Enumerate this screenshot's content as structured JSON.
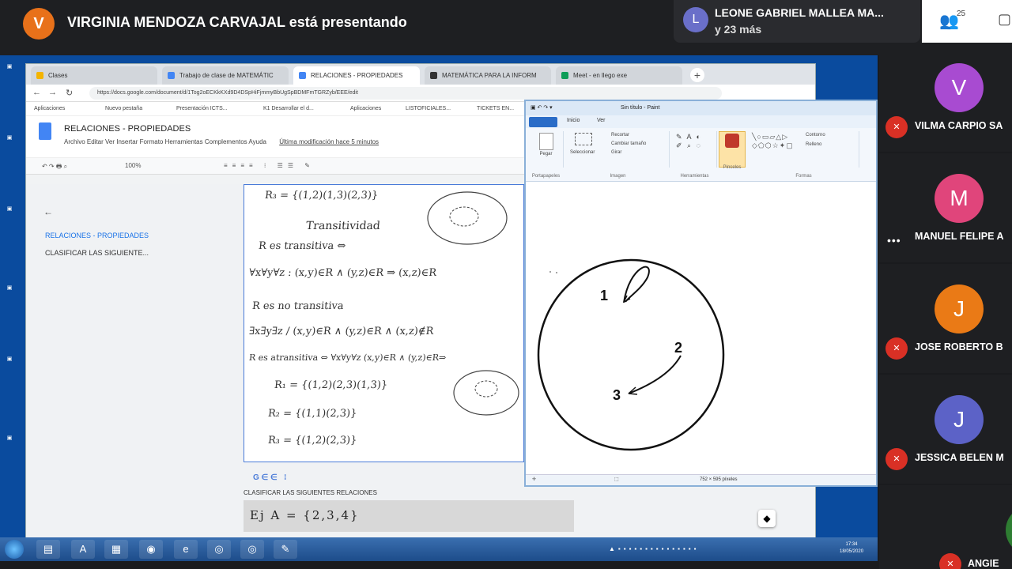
{
  "meet": {
    "presenter_initial": "V",
    "presenter_text": "VIRGINIA MENDOZA CARVAJAL está presentando",
    "top_participant_initial": "L",
    "top_participant_name": "LEONE GABRIEL MALLEA MA...",
    "top_participant_more": "y 23 más",
    "people_count": "25",
    "participants": [
      {
        "initial": "V",
        "name": "VILMA CARPIO SA",
        "color": "#a84bd1",
        "status": "muted"
      },
      {
        "initial": "M",
        "name": "MANUEL FELIPE A",
        "color": "#e0457b",
        "status": "speaking"
      },
      {
        "initial": "J",
        "name": "JOSE ROBERTO B",
        "color": "#ea7a16",
        "status": "muted"
      },
      {
        "initial": "J",
        "name": "JESSICA BELEN M",
        "color": "#5c62c7",
        "status": "muted"
      },
      {
        "initial": "",
        "name": "ANGIE",
        "color": "#2e7d32",
        "status": "muted"
      }
    ]
  },
  "browser": {
    "tabs": [
      {
        "label": "Clases",
        "color": "#f4b400"
      },
      {
        "label": "Trabajo de clase de MATEMÁTIC",
        "color": "#4285f4"
      },
      {
        "label": "RELACIONES - PROPIEDADES",
        "color": "#4285f4"
      },
      {
        "label": "MATEMÁTICA PARA LA INFORM",
        "color": "#333333"
      },
      {
        "label": "Meet - en llego exe",
        "color": "#0f9d58"
      }
    ],
    "url": "https://docs.google.com/document/d/1Tog2oECKkKXd9D4DSpHiFjmmyBbUgSpBDMFmTGRZyb/EEE/edit",
    "bookmarks": [
      "Aplicaciones",
      "Nuevo pestaña",
      "Presentación ICTS...",
      "K1 Desarrollar el d...",
      "Aplicaciones",
      "LISTOFICIALES...",
      "TICKETS EN..."
    ]
  },
  "docs": {
    "title": "RELACIONES - PROPIEDADES",
    "menu": "Archivo   Editar   Ver   Insertar   Formato   Herramientas   Complementos   Ayuda",
    "last_edit": "Última modificación hace 5 minutos",
    "zoom": "100%",
    "outline": [
      "RELACIONES - PROPIEDADES",
      "CLASIFICAR LAS SIGUIENTE..."
    ],
    "handwriting": [
      "R₃ = {(1,2)(1,3)(2,3)}",
      "Transitividad",
      "R es transitiva ⇔",
      "∀x∀y∀z : (x,y)∈R ∧ (y,z)∈R ⇒ (x,z)∈R",
      "R es no transitiva",
      "∃x∃y∃z / (x,y)∈R ∧ (y,z)∈R ∧ (x,z)∉R",
      "R es atransitiva ⇔ ∀x∀y∀z (x,y)∈R ∧ (y,z)∈R⇒",
      "R₁ = {(1,2)(2,3)(1,3)}",
      "R₂ = {(1,1)(2,3)}",
      "R₃ = {(1,2)(2,3)}"
    ],
    "section_heading": "CLASIFICAR LAS SIGUIENTES RELACIONES",
    "example_text": "Ej  A = {2,3,4}"
  },
  "paint": {
    "title": "Sin título - Paint",
    "tabs": [
      "Inicio",
      "Ver"
    ],
    "groups": [
      "Portapapeles",
      "Imagen",
      "Herramientas",
      "Pinceles",
      "Formas"
    ],
    "commands": [
      "Pegar",
      "Seleccionar",
      "Recortar",
      "Cambiar tamaño",
      "Girar",
      "Contorno",
      "Relleno"
    ],
    "status": "752 × 595 píxeles",
    "canvas_labels": [
      "1",
      "2",
      "3"
    ]
  },
  "taskbar": {
    "time": "17:34",
    "date": "18/05/2020"
  }
}
